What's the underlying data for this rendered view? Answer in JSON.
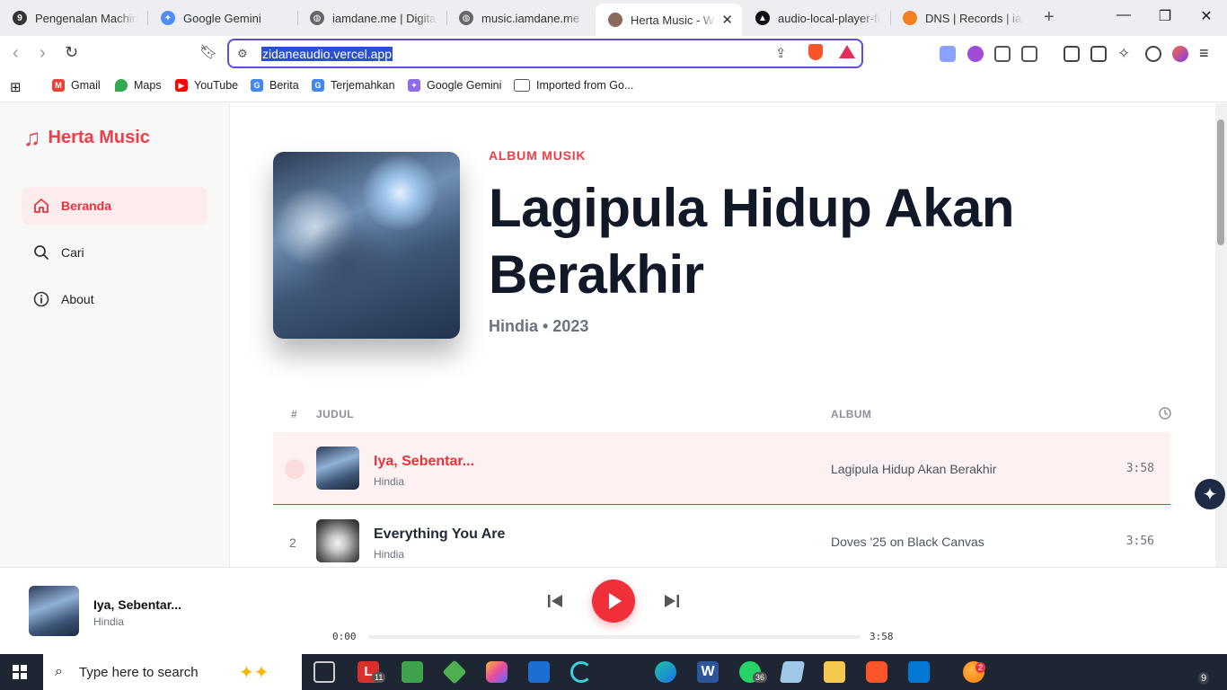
{
  "browser": {
    "tabs": [
      {
        "label": "Pengenalan Machine",
        "icon": "circle-9-icon",
        "color": "#333333"
      },
      {
        "label": "Google Gemini",
        "icon": "gemini-icon",
        "color": "#4f8cf7"
      },
      {
        "label": "iamdane.me | Digital",
        "icon": "globe-icon",
        "color": "#666666"
      },
      {
        "label": "music.iamdane.me",
        "icon": "globe-icon",
        "color": "#666666"
      },
      {
        "label": "Herta Music - We",
        "icon": "herta-avatar-icon",
        "color": "#8a6a5a"
      },
      {
        "label": "audio-local-player-fir",
        "icon": "vercel-icon",
        "color": "#111111"
      },
      {
        "label": "DNS | Records | iamd",
        "icon": "cloudflare-icon",
        "color": "#f38020"
      }
    ],
    "url": "zidaneaudio.vercel.app",
    "bookmarks": [
      {
        "label": "Gmail",
        "icon": "gmail-icon"
      },
      {
        "label": "Maps",
        "icon": "maps-icon"
      },
      {
        "label": "YouTube",
        "icon": "youtube-icon"
      },
      {
        "label": "Berita",
        "icon": "news-icon"
      },
      {
        "label": "Terjemahkan",
        "icon": "translate-icon"
      },
      {
        "label": "Google Gemini",
        "icon": "gemini-icon"
      },
      {
        "label": "Imported from Go...",
        "icon": "folder-icon"
      }
    ]
  },
  "app": {
    "brand": "Herta Music",
    "accent": "#ef3e48",
    "nav": [
      {
        "label": "Beranda",
        "icon": "home-icon",
        "active": true
      },
      {
        "label": "Cari",
        "icon": "search-icon",
        "active": false
      },
      {
        "label": "About",
        "icon": "info-icon",
        "active": false
      }
    ]
  },
  "album": {
    "kicker": "ALBUM MUSIK",
    "title": "Lagipula Hidup Akan Berakhir",
    "meta": "Hindia • 2023"
  },
  "table": {
    "columns": {
      "number": "#",
      "title": "JUDUL",
      "album": "ALBUM",
      "duration_icon": "clock-icon"
    },
    "rows": [
      {
        "number": "",
        "title": "Iya, Sebentar...",
        "artist": "Hindia",
        "album": "Lagipula Hidup Akan Berakhir",
        "duration": "3:58",
        "current": true
      },
      {
        "number": "2",
        "title": "Everything You Are",
        "artist": "Hindia",
        "album": "Doves '25 on Black Canvas",
        "duration": "3:56",
        "current": false
      }
    ]
  },
  "player": {
    "title": "Iya, Sebentar...",
    "artist": "Hindia",
    "current_time": "0:00",
    "total_time": "3:58",
    "progress": 0
  },
  "taskbar": {
    "search_placeholder": "Type here to search",
    "badges": {
      "lolol": "11",
      "whatsapp": "36",
      "weather": "2",
      "notifications": "9"
    }
  }
}
